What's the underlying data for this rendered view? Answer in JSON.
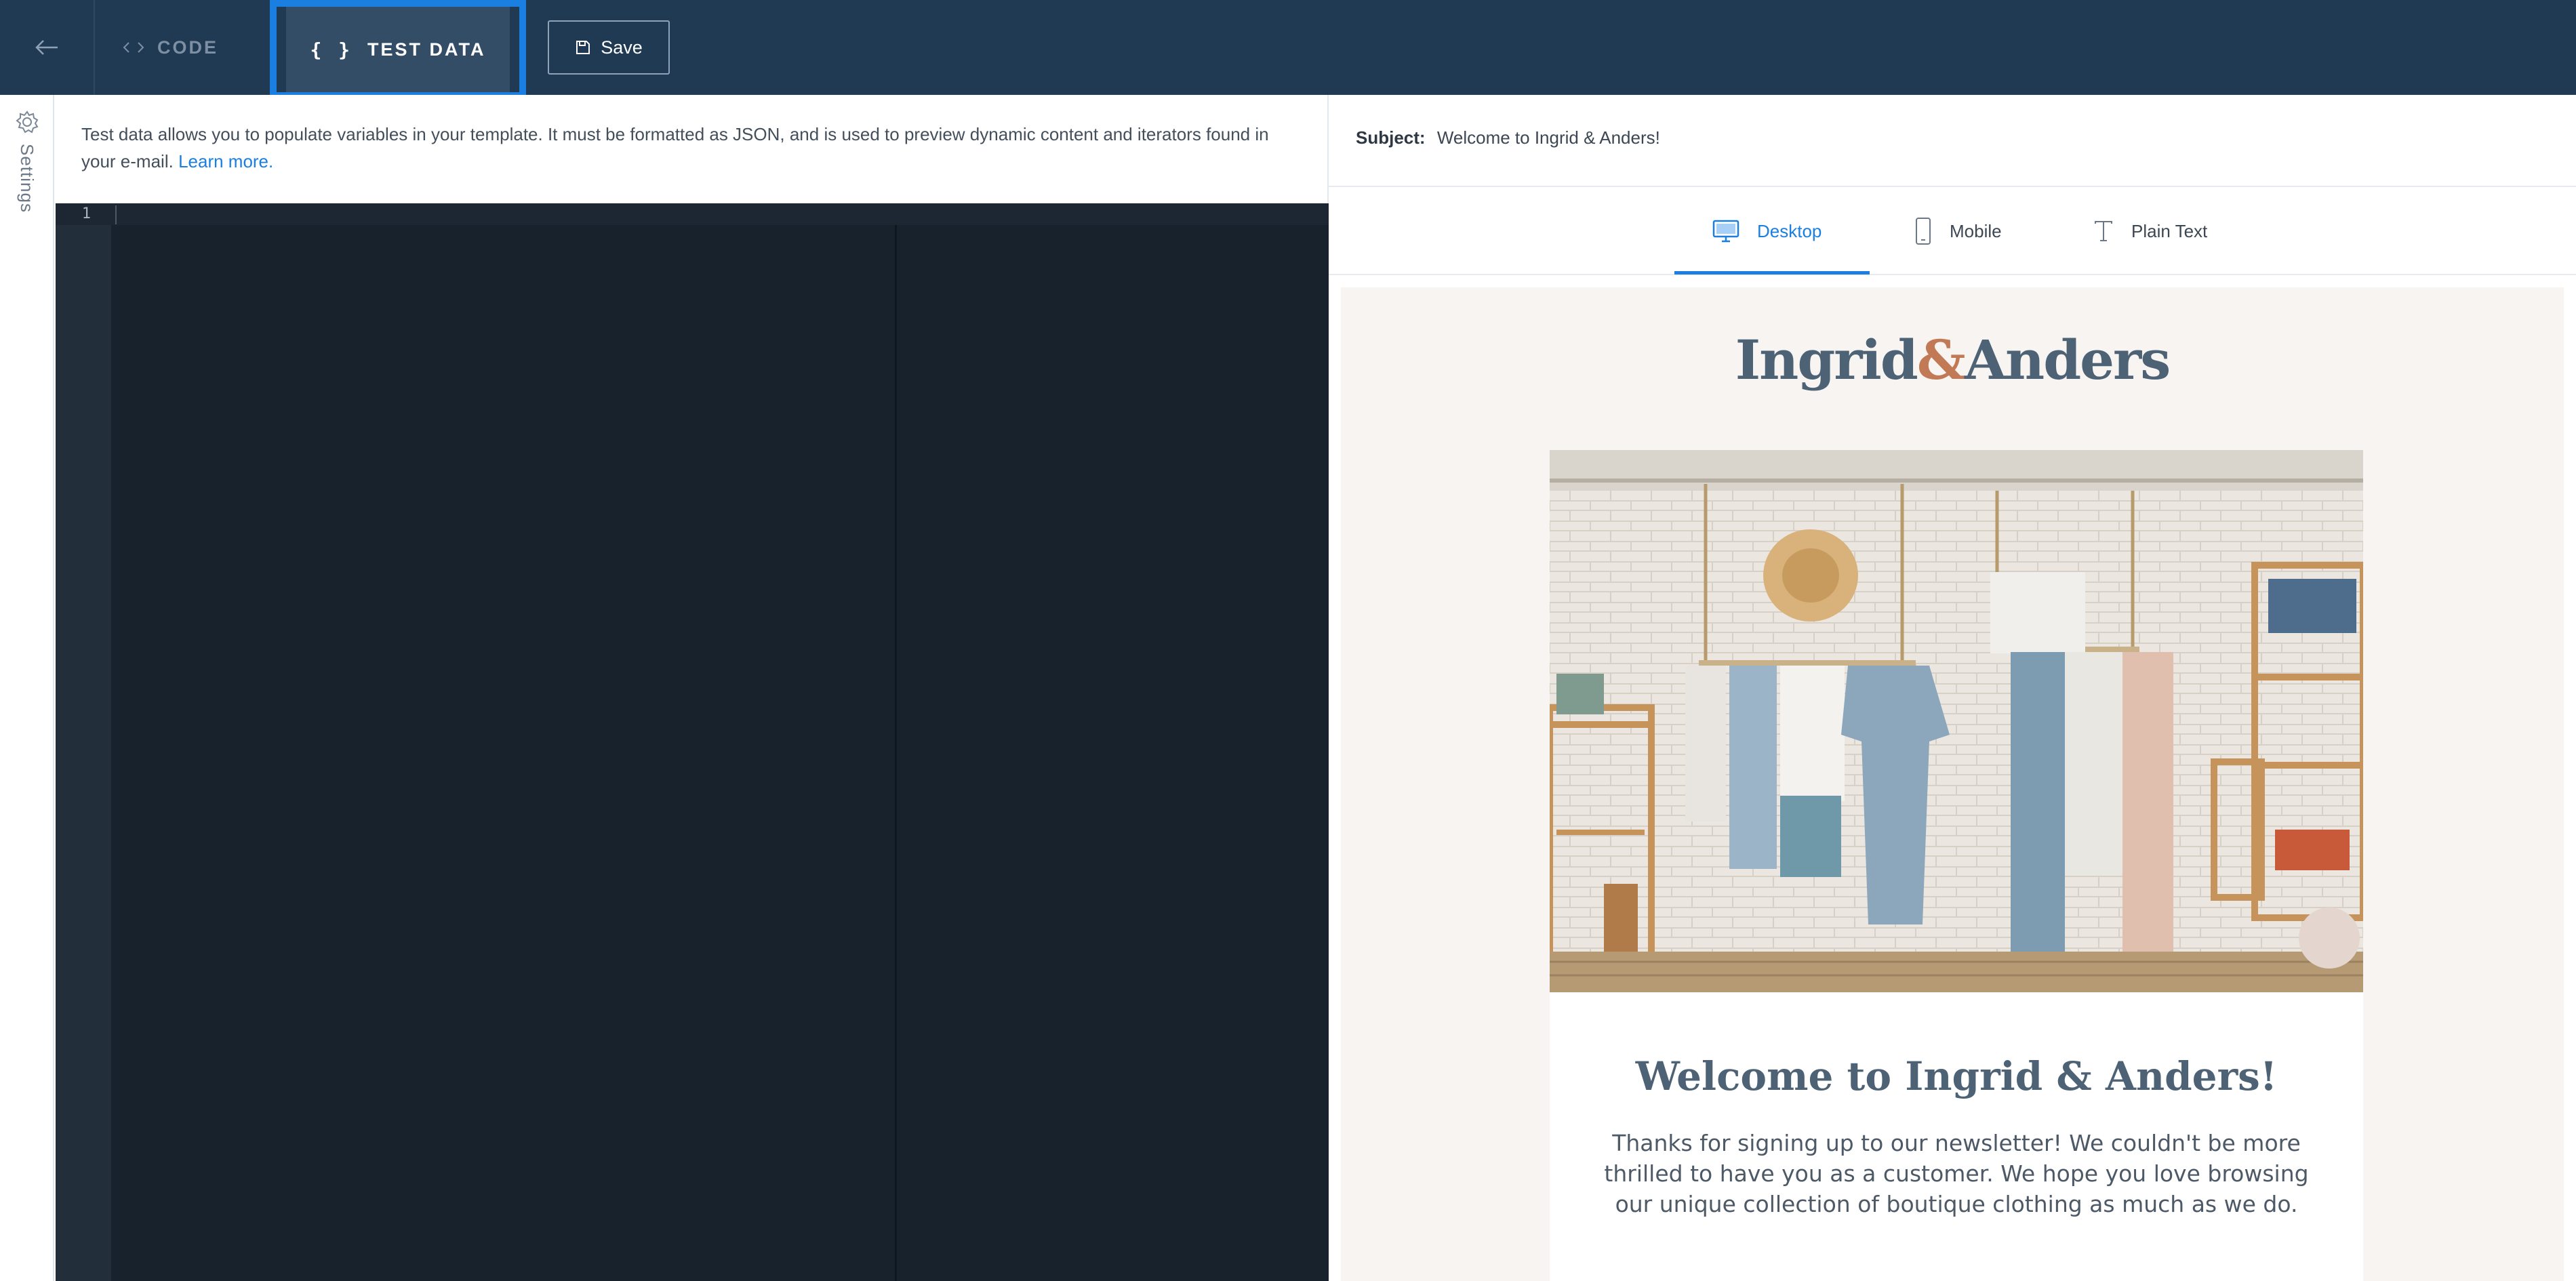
{
  "topbar": {
    "tabs": {
      "code": "CODE",
      "test_data": "TEST DATA",
      "test_data_icon": "{ }"
    },
    "save_label": "Save",
    "icons": [
      "back-arrow-icon",
      "code-icon",
      "braces-icon",
      "save-icon"
    ],
    "accent_color": "#1a7fe0",
    "bar_color": "#213a53"
  },
  "sidebar": {
    "label": "Settings",
    "icon": "gear-icon"
  },
  "editor": {
    "description": "Test data allows you to populate variables in your template. It must be formatted as JSON, and is used to preview dynamic content and iterators found in your e-mail.",
    "learn_more": "Learn more.",
    "line_number": "1"
  },
  "preview": {
    "subject_label": "Subject:",
    "subject_value": "Welcome to Ingrid & Anders!",
    "device_tabs": [
      {
        "label": "Desktop",
        "icon": "desktop-icon",
        "active": true
      },
      {
        "label": "Mobile",
        "icon": "mobile-icon",
        "active": false
      },
      {
        "label": "Plain Text",
        "icon": "text-icon",
        "active": false
      }
    ],
    "email": {
      "brand_left": "Ingrid",
      "brand_amp": "&",
      "brand_right": "Anders",
      "title": "Welcome to Ingrid & Anders!",
      "body": "Thanks for signing up to our newsletter! We couldn't be more thrilled to have you as a customer. We hope you love browsing our unique collection of boutique clothing as much as we do."
    }
  }
}
